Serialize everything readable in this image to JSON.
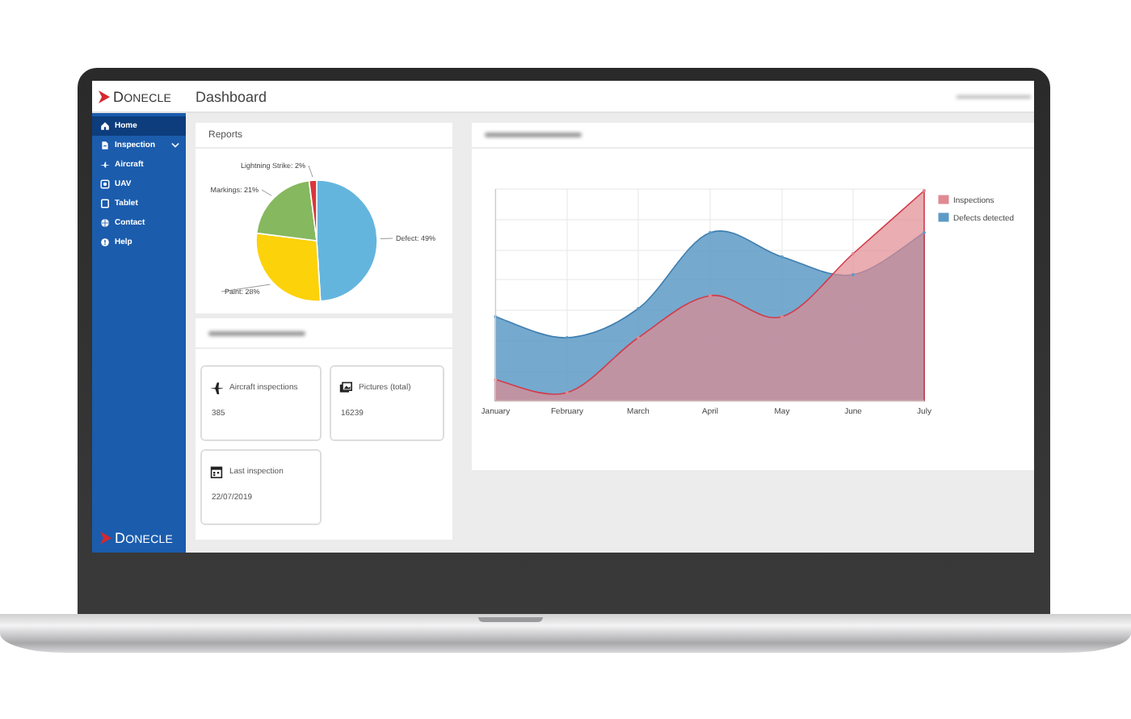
{
  "header": {
    "brand": "DONECLE",
    "title": "Dashboard"
  },
  "sidebar": {
    "items": [
      {
        "label": "Home",
        "selected": true,
        "has_submenu": false
      },
      {
        "label": "Inspection",
        "selected": false,
        "has_submenu": true
      },
      {
        "label": "Aircraft",
        "selected": false,
        "has_submenu": false
      },
      {
        "label": "UAV",
        "selected": false,
        "has_submenu": false
      },
      {
        "label": "Tablet",
        "selected": false,
        "has_submenu": false
      },
      {
        "label": "Contact",
        "selected": false,
        "has_submenu": false
      },
      {
        "label": "Help",
        "selected": false,
        "has_submenu": false
      }
    ],
    "footer_brand": "DONECLE"
  },
  "reports": {
    "title": "Reports",
    "chart_data": {
      "type": "pie",
      "categories": [
        "Defect: 49%",
        "Paint: 28%",
        "Markings: 21%",
        "Lightning Strike: 2%"
      ],
      "values": [
        49,
        28,
        21,
        2
      ],
      "colors": [
        "#64b5de",
        "#fcd20a",
        "#86b85f",
        "#d9373c"
      ]
    }
  },
  "stats": {
    "tiles": [
      {
        "label": "Aircraft inspections",
        "value": "385"
      },
      {
        "label": "Pictures (total)",
        "value": "16239"
      },
      {
        "label": "Last inspection",
        "value": "22/07/2019"
      }
    ]
  },
  "trend": {
    "x_labels": [
      "January",
      "February",
      "March",
      "April",
      "May",
      "June",
      "July"
    ],
    "legend": [
      {
        "name": "Inspections",
        "color": "#e08a92"
      },
      {
        "name": "Defects detected",
        "color": "#5d9ac6"
      }
    ]
  }
}
